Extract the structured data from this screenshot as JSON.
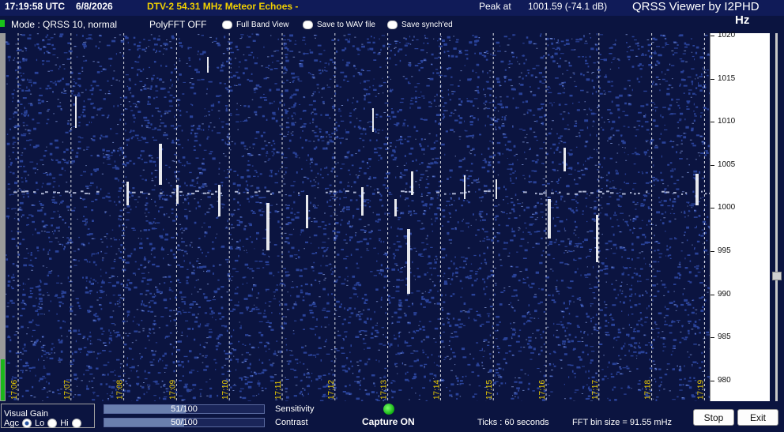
{
  "header": {
    "time": "17:19:58 UTC",
    "date": "6/8/2026",
    "signal_title": "DTV-2 54.31 MHz Meteor Echoes -",
    "peak_label": "Peak at",
    "peak_value": "1001.59 (-74.1 dB)",
    "app_title": "QRSS Viewer by I2PHD",
    "unit": "Hz"
  },
  "options": {
    "mode": "Mode : QRSS 10, normal",
    "polyfft": "PolyFFT OFF",
    "full_band_view": "Full Band View",
    "save_wav": "Save to WAV file",
    "save_synched": "Save synch'ed"
  },
  "spectrogram": {
    "freq_ticks": [
      "1020",
      "1015",
      "1010",
      "1005",
      "1000",
      "995",
      "990",
      "985",
      "980"
    ],
    "time_ticks": [
      "17:06",
      "17:07",
      "17:08",
      "17:09",
      "17:10",
      "17:11",
      "17:12",
      "17:13",
      "17:14",
      "17:15",
      "17:16",
      "17:17",
      "17:18",
      "17:19"
    ],
    "colors": {
      "background": "#0b1440",
      "noise": "#2f4aa8",
      "signal": "#ffffff",
      "gridline": "#ffffff"
    }
  },
  "controls": {
    "visual_gain_label": "Visual Gain",
    "agc_label": "Agc",
    "lo_label": "Lo",
    "hi_label": "Hi",
    "selected_gain": "Agc",
    "sensitivity_label": "Sensitivity",
    "sensitivity_text": "51/100",
    "sensitivity_fraction": 0.51,
    "contrast_label": "Contrast",
    "contrast_text": "50/100",
    "contrast_fraction": 0.5,
    "capture_text": "Capture ON",
    "capture_color": "#19c219",
    "ticks_text": "Ticks   : 60 seconds",
    "fft_bin_text": "FFT bin size = 91.55 mHz",
    "stop_label": "Stop",
    "exit_label": "Exit"
  }
}
